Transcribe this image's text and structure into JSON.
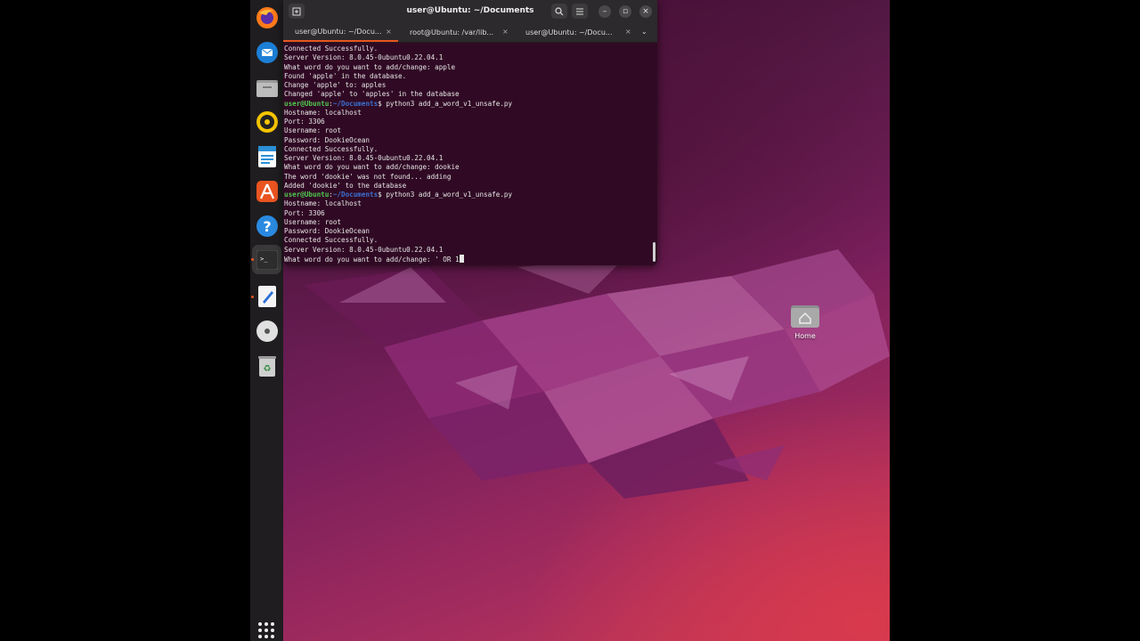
{
  "window": {
    "title": "user@Ubuntu: ~/Documents"
  },
  "tabs": [
    {
      "label": "user@Ubuntu: ~/Docu...",
      "active": true
    },
    {
      "label": "root@Ubuntu: /var/lib...",
      "active": false
    },
    {
      "label": "user@Ubuntu: ~/Docu...",
      "active": false
    }
  ],
  "terminal": {
    "lines": [
      {
        "text": "Connected Successfully."
      },
      {
        "text": "Server Version: 8.0.45-0ubuntu0.22.04.1"
      },
      {
        "text": "What word do you want to add/change: apple"
      },
      {
        "text": "Found 'apple' in the database."
      },
      {
        "text": "Change 'apple' to: apples"
      },
      {
        "text": "Changed 'apple' to 'apples' in the database"
      },
      {
        "prompt_user": "user@Ubuntu",
        "prompt_path": "~/Documents",
        "command": "$ python3 add_a_word_v1_unsafe.py"
      },
      {
        "text": "Hostname: localhost"
      },
      {
        "text": "Port: 3306"
      },
      {
        "text": "Username: root"
      },
      {
        "text": "Password: DookieOcean"
      },
      {
        "text": "Connected Successfully."
      },
      {
        "text": "Server Version: 8.0.45-0ubuntu0.22.04.1"
      },
      {
        "text": "What word do you want to add/change: dookie"
      },
      {
        "text": "The word 'dookie' was not found... adding"
      },
      {
        "text": "Added 'dookie' to the database"
      },
      {
        "prompt_user": "user@Ubuntu",
        "prompt_path": "~/Documents",
        "command": "$ python3 add_a_word_v1_unsafe.py"
      },
      {
        "text": "Hostname: localhost"
      },
      {
        "text": "Port: 3306"
      },
      {
        "text": "Username: root"
      },
      {
        "text": "Password: DookieOcean"
      },
      {
        "text": "Connected Successfully."
      },
      {
        "text": "Server Version: 8.0.45-0ubuntu0.22.04.1"
      },
      {
        "text": "What word do you want to add/change: ' OR 1",
        "cursor": true
      }
    ]
  },
  "dock": {
    "items": [
      "firefox-icon",
      "thunderbird-icon",
      "files-icon",
      "rhythmbox-icon",
      "writer-icon",
      "app-center-icon",
      "help-icon",
      "terminal-icon",
      "text-editor-icon",
      "dvd-icon",
      "trash-icon"
    ],
    "show_apps": "show-apps-icon"
  },
  "desktop": {
    "home_label": "Home"
  },
  "colors": {
    "terminal_bg": "#300a24",
    "prompt_user": "#4ec94e",
    "prompt_path": "#3b6fd0",
    "accent": "#e95420"
  }
}
